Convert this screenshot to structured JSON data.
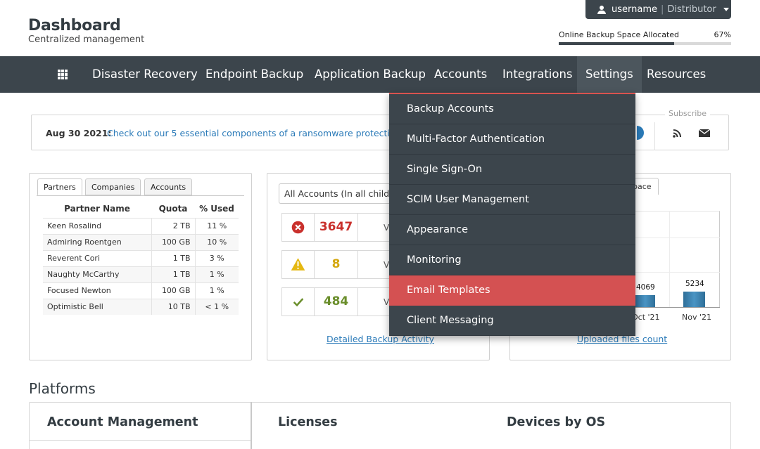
{
  "header": {
    "title": "Dashboard",
    "subtitle": "Centralized management",
    "user": {
      "name": "username",
      "separator": "|",
      "role": "Distributor"
    },
    "space": {
      "label": "Online Backup Space Allocated",
      "percent_text": "67%",
      "fraction": 0.67
    }
  },
  "nav": {
    "items": [
      "Disaster Recovery",
      "Endpoint Backup",
      "Application Backup",
      "Accounts",
      "Integrations",
      "Settings",
      "Resources"
    ],
    "active": "Settings"
  },
  "announcement": {
    "date": "Aug 30 2021:",
    "text": "Check out our 5 essential components of a ransomware protection",
    "subscribe_label": "Subscribe"
  },
  "partners_panel": {
    "tabs": [
      "Partners",
      "Companies",
      "Accounts"
    ],
    "active_tab": "Partners",
    "columns": [
      "Partner Name",
      "Quota",
      "% Used"
    ],
    "rows": [
      [
        "Keen Rosalind",
        "2 TB",
        "11 %"
      ],
      [
        "Admiring Roentgen",
        "100 GB",
        "10 %"
      ],
      [
        "Reverent Cori",
        "1 TB",
        "3 %"
      ],
      [
        "Naughty McCarthy",
        "1 TB",
        "1 %"
      ],
      [
        "Focused Newton",
        "100 GB",
        "1 %"
      ],
      [
        "Optimistic Bell",
        "10 TB",
        "< 1 %"
      ]
    ]
  },
  "backup_panel": {
    "select_value": "All Accounts (In all child r",
    "stats": [
      {
        "value": "3647",
        "suffix": "V",
        "status": "error",
        "color": "#c9302c"
      },
      {
        "value": "8",
        "suffix": "V",
        "status": "warning",
        "color": "#d4a810"
      },
      {
        "value": "484",
        "suffix": "V",
        "status": "success",
        "color": "#6a8e2b"
      }
    ],
    "link": "Detailed Backup Activity"
  },
  "files_panel": {
    "tab_label": "pace",
    "bars": [
      {
        "label": "4069",
        "x_label": "Oct '21",
        "value": 4069
      },
      {
        "label": "5234",
        "x_label": "Nov '21",
        "value": 5234
      }
    ],
    "link": "Uploaded files count"
  },
  "platforms": {
    "title": "Platforms",
    "sections": [
      "Account Management",
      "Licenses",
      "Devices by OS"
    ]
  },
  "settings_menu": {
    "items": [
      "Backup Accounts",
      "Multi-Factor Authentication",
      "Single Sign-On",
      "SCIM User Management",
      "Appearance",
      "Monitoring",
      "Email Templates",
      "Client Messaging"
    ],
    "active": "Email Templates"
  },
  "colors": {
    "nav_bg": "#3c454c",
    "accent_red": "#d45152",
    "link_blue": "#2a7ab8"
  }
}
